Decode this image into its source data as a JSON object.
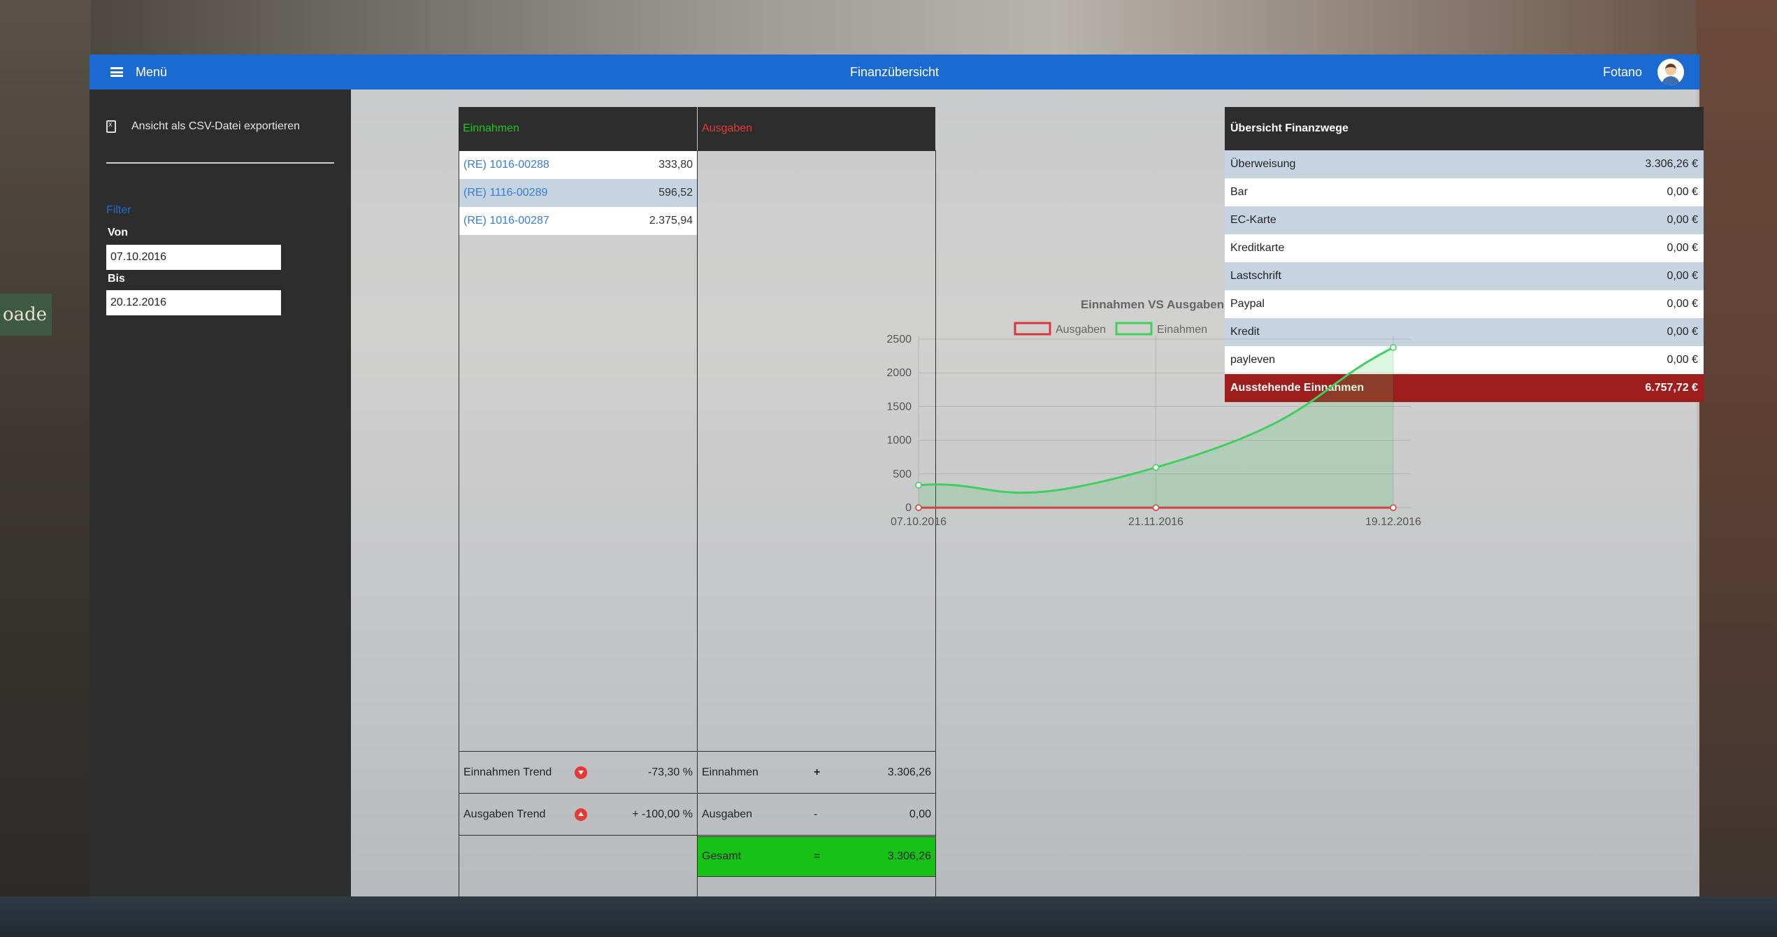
{
  "topbar": {
    "menu_label": "Menü",
    "title": "Finanzübersicht",
    "user_name": "Fotano"
  },
  "sidebar": {
    "export_label": "Ansicht als CSV-Datei exportieren",
    "filter_title": "Filter",
    "from_label": "Von",
    "from_value": "07.10.2016",
    "to_label": "Bis",
    "to_value": "20.12.2016"
  },
  "ledger": {
    "income_header": "Einnahmen",
    "expense_header": "Ausgaben",
    "income_rows": [
      {
        "ref": "(RE) 1016-00288",
        "amount": "333,80"
      },
      {
        "ref": "(RE) 1116-00289",
        "amount": "596,52"
      },
      {
        "ref": "(RE) 1016-00287",
        "amount": "2.375,94"
      }
    ],
    "trend_income_label": "Einnahmen Trend",
    "trend_income_value": "-73,30 %",
    "trend_expense_label": "Ausgaben Trend",
    "trend_expense_value": "+ -100,00 %",
    "sum_income_label": "Einnahmen",
    "sum_income_op": "+",
    "sum_income_value": "3.306,26",
    "sum_expense_label": "Ausgaben",
    "sum_expense_op": "-",
    "sum_expense_value": "0,00",
    "total_label": "Gesamt",
    "total_op": "=",
    "total_value": "3.306,26"
  },
  "payment_overview": {
    "header": "Übersicht Finanzwege",
    "rows": [
      {
        "label": "Überweisung",
        "value": "3.306,26 €"
      },
      {
        "label": "Bar",
        "value": "0,00 €"
      },
      {
        "label": "EC-Karte",
        "value": "0,00 €"
      },
      {
        "label": "Kreditkarte",
        "value": "0,00 €"
      },
      {
        "label": "Lastschrift",
        "value": "0,00 €"
      },
      {
        "label": "Paypal",
        "value": "0,00 €"
      },
      {
        "label": "Kredit",
        "value": "0,00 €"
      },
      {
        "label": "payleven",
        "value": "0,00 €"
      }
    ],
    "outstanding_label": "Ausstehende Einnahmen",
    "outstanding_value": "6.757,72 €"
  },
  "colors": {
    "topbar": "#1a6ad2",
    "income_green": "#22c51e",
    "expense_red": "#e53935",
    "row_alt": "#c6d4e2",
    "total_green": "#17c217",
    "outstanding_red": "#9e1d1d"
  },
  "chart_data": {
    "type": "line",
    "title": "Einnahmen VS Ausgaben",
    "x": [
      "07.10.2016",
      "21.11.2016",
      "19.12.2016"
    ],
    "series": [
      {
        "name": "Ausgaben",
        "values": [
          0,
          0,
          0
        ],
        "color": "#d9363e"
      },
      {
        "name": "Einahmen",
        "values": [
          333.8,
          596.52,
          2375.94
        ],
        "color": "#3fcf5f"
      }
    ],
    "yticks": [
      0,
      500,
      1000,
      1500,
      2000,
      2500
    ],
    "ylim": [
      0,
      2500
    ],
    "grid": true,
    "legend": "top-center"
  }
}
